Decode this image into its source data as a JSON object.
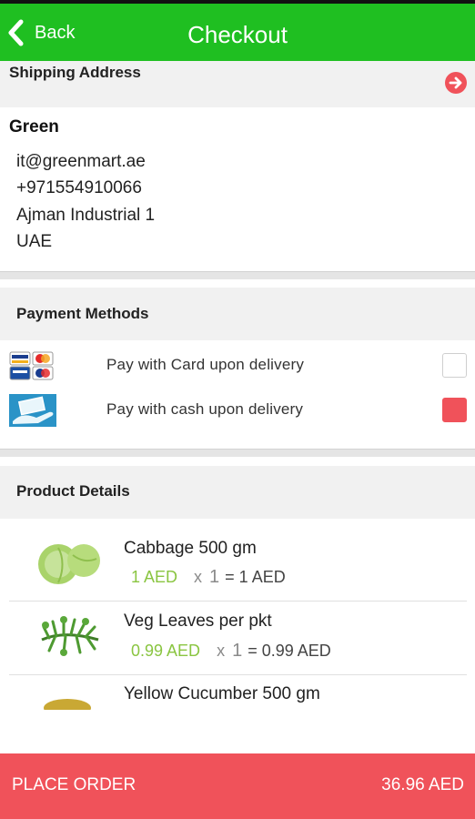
{
  "appbar": {
    "back_label": "Back",
    "title": "Checkout"
  },
  "shipping": {
    "header": "Shipping Address",
    "name": "Green",
    "lines": [
      "it@greenmart.ae",
      "+971554910066",
      "Ajman Industrial 1",
      "UAE"
    ]
  },
  "payment": {
    "header": "Payment Methods",
    "methods": [
      {
        "label": "Pay with Card upon delivery",
        "icon": "credit-cards-icon",
        "selected": false
      },
      {
        "label": "Pay with cash upon delivery",
        "icon": "cash-hand-icon",
        "selected": true
      }
    ]
  },
  "products": {
    "header": "Product Details",
    "items": [
      {
        "name": "Cabbage 500 gm",
        "price": "1 AED",
        "x": "x",
        "qty": "1",
        "total": "= 1 AED"
      },
      {
        "name": "Veg Leaves per pkt",
        "price": "0.99 AED",
        "x": "x",
        "qty": "1",
        "total": "= 0.99 AED"
      },
      {
        "name": "Yellow Cucumber 500 gm"
      }
    ]
  },
  "footer": {
    "place_order": "PLACE ORDER",
    "total": "36.96 AED"
  },
  "colors": {
    "appbar": "#1fbf21",
    "accent_red": "#f0525a",
    "price_green": "#8ac541"
  }
}
